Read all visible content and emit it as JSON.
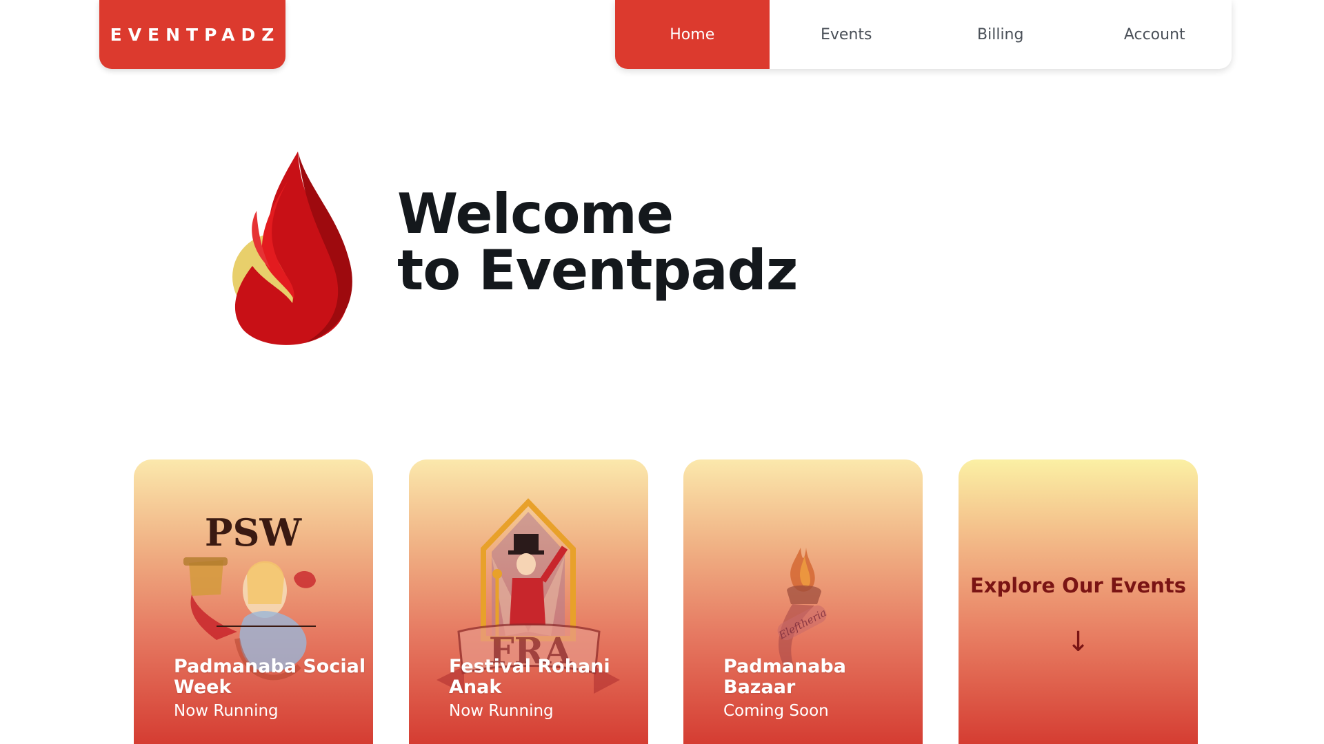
{
  "brand": {
    "name": "EVENTPADZ"
  },
  "nav": {
    "items": [
      {
        "label": "Home",
        "active": true
      },
      {
        "label": "Events",
        "active": false
      },
      {
        "label": "Billing",
        "active": false
      },
      {
        "label": "Account",
        "active": false
      }
    ]
  },
  "hero": {
    "title_line1": "Welcome",
    "title_line2": "to Eventpadz",
    "logo_icon": "flame-logo-icon"
  },
  "cards": [
    {
      "title": "Padmanaba Social Week",
      "status": "Now Running",
      "art_text": "PSW",
      "icon": "mad-hatter-tea-party-icon"
    },
    {
      "title": "Festival Rohani Anak",
      "status": "Now Running",
      "art_text": "FRA",
      "icon": "ringmaster-circus-icon"
    },
    {
      "title": "Padmanaba Bazaar",
      "status": "Coming Soon",
      "art_text": "Eleftheria",
      "icon": "torch-icon"
    }
  ],
  "explore": {
    "title": "Explore Our Events",
    "arrow": "↓"
  },
  "colors": {
    "accent": "#dc3a2e",
    "text_dark": "#14181c",
    "explore_text": "#7a1414"
  }
}
